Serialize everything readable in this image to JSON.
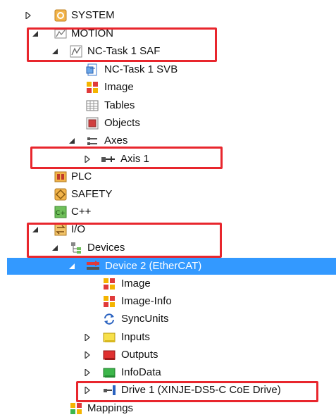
{
  "tree": {
    "system": "SYSTEM",
    "motion": "MOTION",
    "nc_task_saf": "NC-Task 1 SAF",
    "nc_task_svb": "NC-Task 1 SVB",
    "image": "Image",
    "tables": "Tables",
    "objects": "Objects",
    "axes": "Axes",
    "axis1": "Axis 1",
    "plc": "PLC",
    "safety": "SAFETY",
    "cpp": "C++",
    "io": "I/O",
    "devices": "Devices",
    "device2": "Device 2 (EtherCAT)",
    "dev_image": "Image",
    "dev_image_info": "Image-Info",
    "syncunits": "SyncUnits",
    "inputs": "Inputs",
    "outputs": "Outputs",
    "infodata": "InfoData",
    "drive1": "Drive 1 (XINJE-DS5-C CoE Drive)",
    "mappings": "Mappings"
  },
  "icons": {
    "system": "system-icon",
    "motion": "motion-icon",
    "nc_task": "nc-task-icon",
    "nc_task_svb": "nc-task-svb-icon",
    "image": "image-icon",
    "tables": "tables-icon",
    "objects": "objects-icon",
    "axes": "axes-icon",
    "axis": "axis-icon",
    "plc": "plc-icon",
    "safety": "safety-icon",
    "cpp": "cpp-icon",
    "io": "io-icon",
    "devices": "devices-icon",
    "ethercat": "ethercat-device-icon",
    "syncunits": "syncunits-icon",
    "inputs": "inputs-icon",
    "outputs": "outputs-icon",
    "infodata": "infodata-icon",
    "drive": "drive-icon",
    "mappings": "mappings-icon"
  },
  "colors": {
    "selection": "#3399ff",
    "highlight_box": "#e8262d"
  }
}
